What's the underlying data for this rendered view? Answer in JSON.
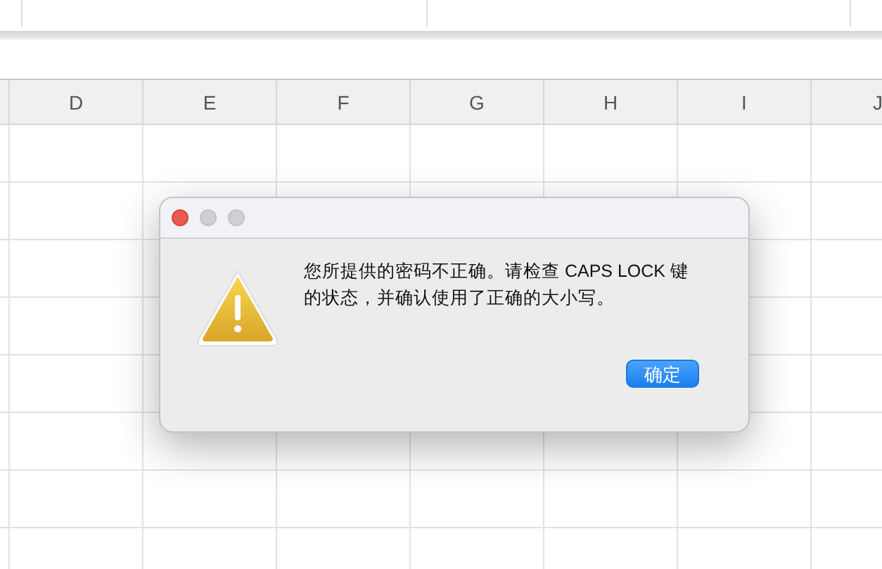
{
  "sheet": {
    "columns": [
      "D",
      "E",
      "F",
      "G",
      "H",
      "I",
      "J"
    ]
  },
  "dialog": {
    "message": "您所提供的密码不正确。请检查 CAPS LOCK 键的状态，并确认使用了正确的大小写。",
    "buttons": [
      {
        "label": "确定",
        "default": true
      }
    ]
  }
}
